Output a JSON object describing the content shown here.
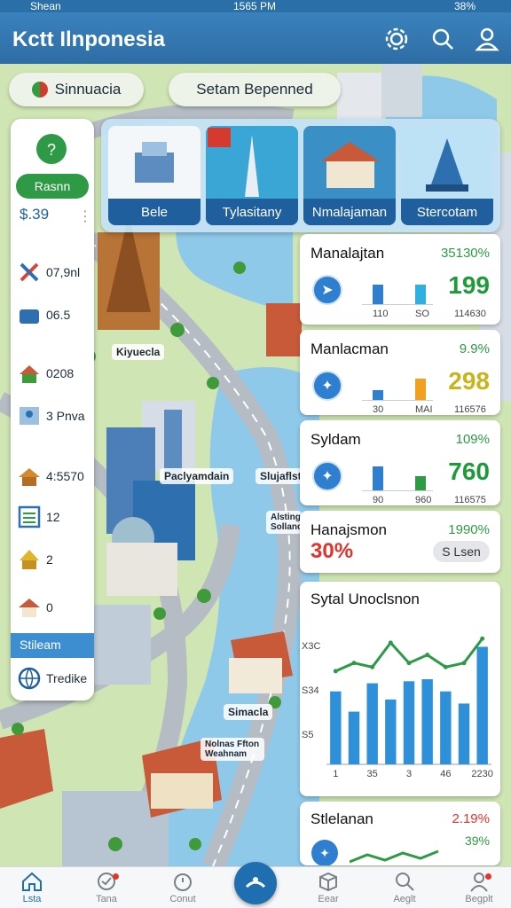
{
  "status_bar": {
    "carrier": "Shean",
    "time": "1565 PM",
    "battery": "38%"
  },
  "header": {
    "title": "Kctt Ilnponesia"
  },
  "pills": {
    "left": "Sinnuacia",
    "right": "Setam Bepenned"
  },
  "categories": [
    {
      "label": "Bele"
    },
    {
      "label": "Tylasitany"
    },
    {
      "label": "Nmalajaman"
    },
    {
      "label": "Stercotam"
    }
  ],
  "left_panel": {
    "button": "Rasnn",
    "price": "$.39",
    "rows": [
      {
        "value": "07,9nl"
      },
      {
        "value": "06.5"
      },
      {
        "value": "0208"
      },
      {
        "value": "3 Pnva"
      },
      {
        "value": "4:5570"
      },
      {
        "value": "12"
      },
      {
        "value": "2"
      },
      {
        "value": "0"
      }
    ],
    "highlight": "Stileam",
    "footer": "Tredike"
  },
  "map_labels": {
    "a": "Kiyuecla",
    "b": "Paclyamdain",
    "c": "Slujaflst",
    "d": "Alsting Solland",
    "e": "Simacla",
    "f": "Nolnas Ffton Weahnam"
  },
  "stats": [
    {
      "title": "Manalajtan",
      "pct": "35130%",
      "big": "199",
      "big_color": "#1e9a3a",
      "ticks": [
        "110",
        "SO",
        "114630"
      ],
      "bars": [
        {
          "h": 0.7,
          "c": "#2e7fd0"
        },
        {
          "h": 0.7,
          "c": "#2eb0e0"
        }
      ]
    },
    {
      "title": "Manlacman",
      "pct": "9.9%",
      "big": "298",
      "big_color": "#c8b51c",
      "ticks": [
        "30",
        "MAI",
        "116576"
      ],
      "bars": [
        {
          "h": 0.35,
          "c": "#2e7fd0"
        },
        {
          "h": 0.75,
          "c": "#f0a21e"
        }
      ]
    },
    {
      "title": "Syldam",
      "pct": "109%",
      "big": "760",
      "big_color": "#1e9a3a",
      "ticks": [
        "90",
        "960",
        "116575"
      ],
      "bars": [
        {
          "h": 0.85,
          "c": "#2e7fd0"
        },
        {
          "h": 0.5,
          "c": "#2e9a45"
        }
      ]
    }
  ],
  "promo": {
    "title": "Hanajsmon",
    "pct": "1990%",
    "big": "30%",
    "button": "S Lsen"
  },
  "chart_card": {
    "title": "Sytal Unoclsnon"
  },
  "chart_data": {
    "type": "bar",
    "categories": [
      "1",
      "",
      "35",
      "",
      "3",
      "",
      "46",
      "",
      "2230"
    ],
    "values": [
      180,
      130,
      200,
      160,
      205,
      210,
      180,
      150,
      290
    ],
    "line_values": [
      230,
      250,
      240,
      300,
      250,
      270,
      240,
      250,
      310
    ],
    "y_ticks": [
      "X3C",
      "S34",
      "S5"
    ],
    "bar_color": "#2e90d8",
    "line_color": "#2e9a45",
    "ylim": [
      0,
      350
    ]
  },
  "bottom_card": {
    "title": "Stlelanan",
    "pct1": "2.19%",
    "pct2": "39%"
  },
  "tabs": [
    {
      "label": "Lsta",
      "icon": "home-icon",
      "active": true
    },
    {
      "label": "Tana",
      "icon": "tasks-icon",
      "dot": true
    },
    {
      "label": "Conut",
      "icon": "timer-icon"
    },
    {
      "label": "Eear",
      "icon": "box-icon"
    },
    {
      "label": "Aeglt",
      "icon": "search-icon"
    },
    {
      "label": "Begplt",
      "icon": "profile-icon",
      "dot": true
    }
  ]
}
